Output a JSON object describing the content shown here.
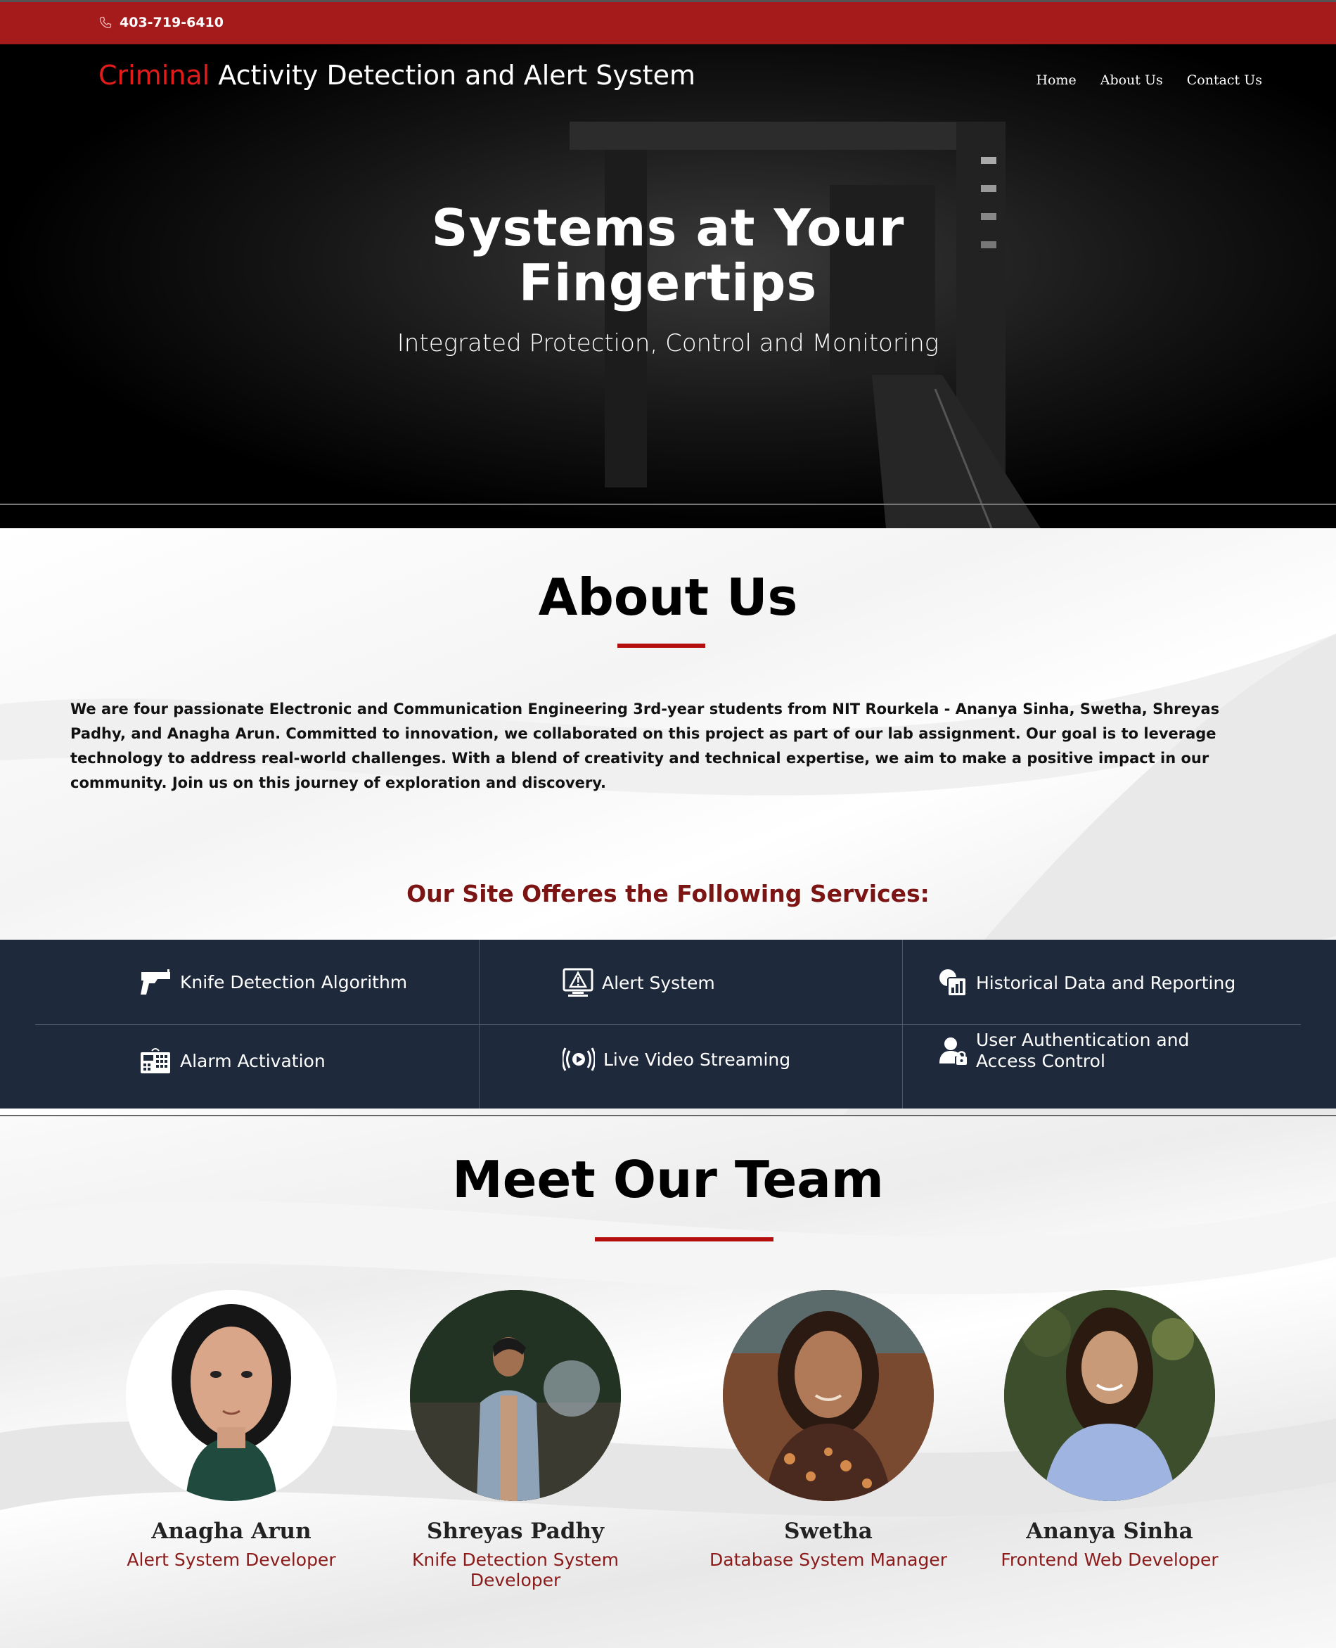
{
  "topbar": {
    "phone": "403-719-6410"
  },
  "header": {
    "brand_accent": "Criminal",
    "brand_rest": " Activity Detection and Alert System",
    "nav": [
      "Home",
      "About Us",
      "Contact Us"
    ]
  },
  "hero": {
    "title_line1": "Systems at Your",
    "title_line2": "Fingertips",
    "subtitle": "Integrated Protection, Control and Monitoring"
  },
  "about": {
    "title": "About Us",
    "text": "We are four passionate Electronic and Communication Engineering 3rd-year students from NIT Rourkela - Ananya Sinha, Swetha, Shreyas Padhy, and Anagha Arun. Committed to innovation, we collaborated on this project as part of our lab assignment. Our goal is to leverage technology to address real-world challenges. With a blend of creativity and technical expertise, we aim to make a positive impact in our community. Join us on this journey of exploration and discovery.",
    "services_heading": "Our Site Offeres the Following Services:"
  },
  "services": [
    {
      "label": "Knife Detection Algorithm",
      "icon": "gun-icon"
    },
    {
      "label": "Alert System",
      "icon": "alert-monitor-icon"
    },
    {
      "label": "Historical Data and Reporting",
      "icon": "report-icon"
    },
    {
      "label": "Alarm Activation",
      "icon": "alarm-panel-icon"
    },
    {
      "label": "Live Video Streaming",
      "icon": "live-stream-icon"
    },
    {
      "label": "User Authentication and Access Control",
      "icon": "user-lock-icon"
    }
  ],
  "team": {
    "title": "Meet Our Team",
    "members": [
      {
        "name": "Anagha Arun",
        "role": "Alert System Developer"
      },
      {
        "name": "Shreyas Padhy",
        "role": "Knife Detection System Developer"
      },
      {
        "name": "Swetha",
        "role": "Database System Manager"
      },
      {
        "name": "Ananya Sinha",
        "role": "Frontend Web Developer"
      }
    ]
  },
  "colors": {
    "accent": "#a51a1a",
    "brand_red": "#e21b1b",
    "services_bg": "#1e293b",
    "role_text": "#8b1a1a"
  }
}
